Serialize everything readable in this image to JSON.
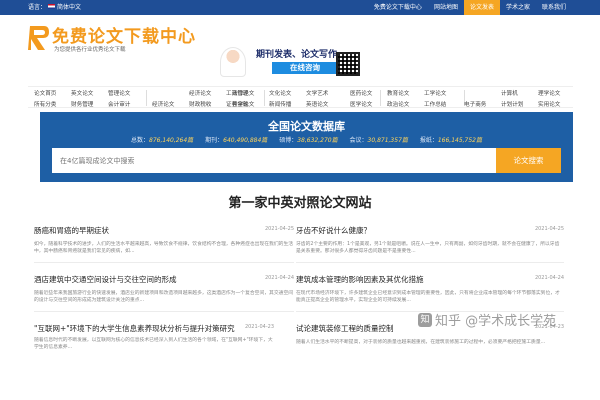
{
  "topbar": {
    "language_label": "语言：",
    "language_value": "简体中文",
    "links": [
      {
        "label": "免费论文下载中心",
        "active": false
      },
      {
        "label": "网站地图",
        "active": false
      },
      {
        "label": "论文发表",
        "active": true
      },
      {
        "label": "学术之家",
        "active": false
      },
      {
        "label": "联系我们",
        "active": false
      }
    ]
  },
  "header": {
    "logo_title": "免费论文下载中心",
    "logo_subtitle": "为您提供各行业优秀论文下载",
    "ad": {
      "headline": "期刊发表、论文写作",
      "button_label": "在线咨询"
    }
  },
  "categories": {
    "groups": [
      {
        "row1": [
          "论文首页",
          "英文论文",
          "管理论文"
        ],
        "row2": [
          "所有分类",
          "财务管理",
          "会计审计"
        ]
      },
      {
        "row1": [
          "经济论文",
          "工商管理"
        ],
        "row2": [
          "经济论文",
          "财政税收",
          "证券金融"
        ]
      },
      {
        "row1": [
          "法律论文",
          "文化论文",
          "文学艺术"
        ],
        "row2": [
          "哲学论文",
          "新闻传播",
          "英语论文"
        ]
      },
      {
        "row1": [
          "医药论文",
          "教育论文",
          "工学论文"
        ],
        "row2": [
          "医学论文",
          "政治论文",
          "工作总结"
        ]
      },
      {
        "row1": [
          "计算机",
          "理学论文"
        ],
        "row2": [
          "电子商务",
          "计划计划",
          "实用论文"
        ]
      }
    ]
  },
  "hero": {
    "title": "全国论文数据库",
    "stats": [
      {
        "label": "总数：",
        "value": "876,140,264篇"
      },
      {
        "label": "期刊：",
        "value": "640,490,884篇"
      },
      {
        "label": "硕博：",
        "value": "38,632,270篇"
      },
      {
        "label": "会议：",
        "value": "30,871,357篇"
      },
      {
        "label": "报纸：",
        "value": "166,145,752篇"
      }
    ],
    "search_placeholder": "在4亿篇现成论文中搜索",
    "search_button": "论文搜索"
  },
  "section": {
    "title": "第一家中英对照论文网站"
  },
  "articles": [
    {
      "title": "肠癌和胃癌的早期症状",
      "date": "2021-04-25",
      "desc": "如今，随着科学技术的进步，人们的生活水平越来越高，导致饮食不规律，饮食结构不合理，各种癌症也出现在我们的生活中，其中肠癌和胃癌就是我们常见的疾病，如..."
    },
    {
      "title": "牙齿不好说什么健康？",
      "date": "2021-04-25",
      "desc": "牙齿的2个主要的作用：1个是美观，另1个就是咀嚼。说在人一生中，只有两副，如何牙齿时期，就不会在健康了，所以牙齿是关系重要。那对很多人都觉得牙齿问题是不是重要性..."
    },
    {
      "title": "酒店建筑中交通空间设计与交往空间的形成",
      "date": "2021-04-24",
      "desc": "随着近些年来我国旅游行业的快速发展，酒店业的新建项目和改造项目越来越多，这类酒店作为一个复合空间，其交通空间的设计与交往空间的形成成为建筑设计关注的重点..."
    },
    {
      "title": "建筑成本管理的影响因素及其优化措施",
      "date": "2021-04-24",
      "desc": "在现代市场经济环境下，许多建筑企业已经意识到成本管理的重要性，因此，只有将企业成本管理的每个环节都落实到位，才能真正提高企业的管理水平，实现企业的可持续发展..."
    },
    {
      "title": "\"互联网+\"环境下的大学生信息素养现状分析与提升对策研究",
      "date": "2021-04-23",
      "desc": "随着信息时代的不断发展，以互联网为核心的信息技术已经深入到人们生活的各个领域，在\"互联网+\"环境下，大学生的信息素养..."
    },
    {
      "title": "试论建筑装修工程的质量控制",
      "date": "2021-04-23",
      "desc": "随着人们生活水平的不断提高，对于装修的质量也越来越重视，在建筑装修施工的过程中，必须要严格把控施工质量..."
    }
  ],
  "watermark": {
    "badge": "知",
    "text": "知乎 @学术成长学苑"
  }
}
